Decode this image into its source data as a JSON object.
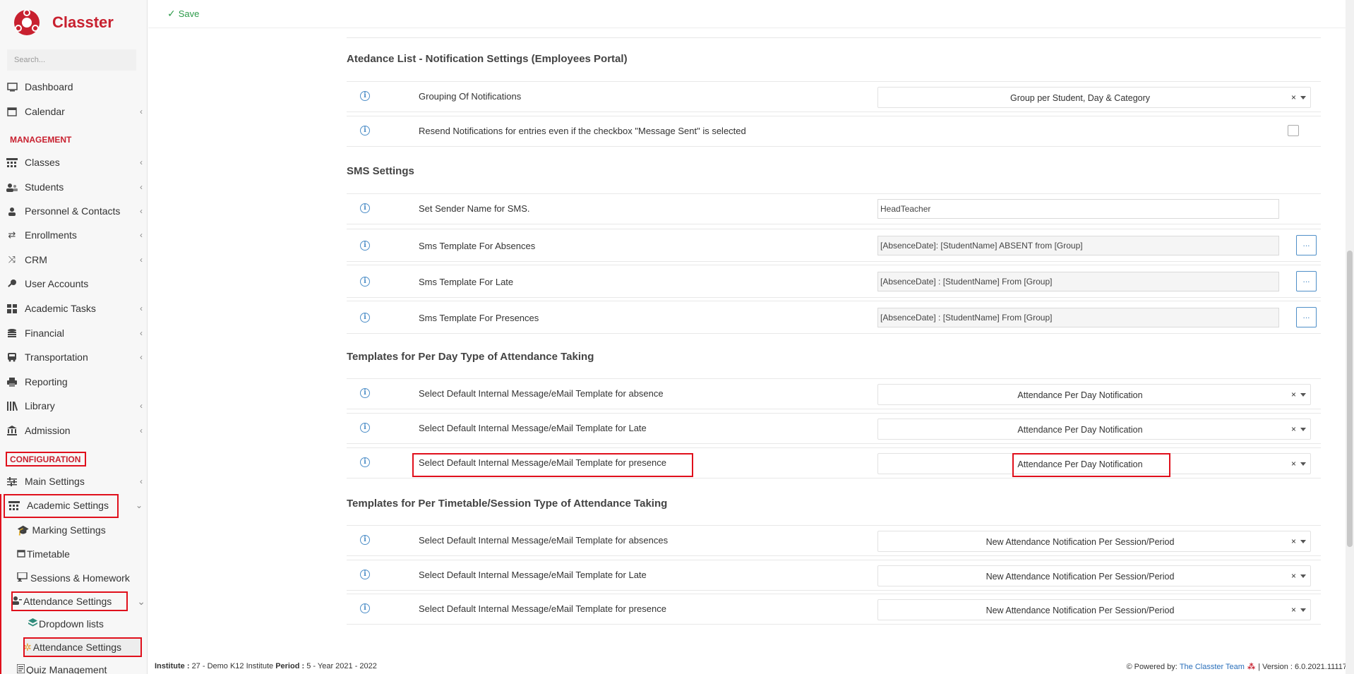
{
  "app": {
    "name": "Classter"
  },
  "toolbar": {
    "save_label": "Save"
  },
  "sidebar": {
    "search_placeholder": "Search...",
    "top_items": [
      {
        "label": "Dashboard",
        "icon": "monitor-icon"
      },
      {
        "label": "Calendar",
        "icon": "calendar-icon"
      }
    ],
    "management_head": "MANAGEMENT",
    "management_items": [
      {
        "label": "Classes",
        "icon": "classes-icon"
      },
      {
        "label": "Students",
        "icon": "students-icon"
      },
      {
        "label": "Personnel & Contacts",
        "icon": "personnel-icon"
      },
      {
        "label": "Enrollments",
        "icon": "enrollments-icon"
      },
      {
        "label": "CRM",
        "icon": "crm-icon"
      },
      {
        "label": "User Accounts",
        "icon": "key-icon"
      },
      {
        "label": "Academic Tasks",
        "icon": "tasks-icon"
      },
      {
        "label": "Financial",
        "icon": "coins-icon"
      },
      {
        "label": "Transportation",
        "icon": "bus-icon"
      },
      {
        "label": "Reporting",
        "icon": "printer-icon"
      },
      {
        "label": "Library",
        "icon": "library-icon"
      },
      {
        "label": "Admission",
        "icon": "bank-icon"
      }
    ],
    "configuration_head": "CONFIGURATION",
    "config_items": [
      {
        "label": "Main Settings",
        "icon": "sliders-icon"
      },
      {
        "label": "Academic Settings",
        "icon": "academic-icon"
      }
    ],
    "academic_sub": [
      {
        "label": "Marking Settings",
        "icon": "graduation-cap-icon"
      },
      {
        "label": "Timetable",
        "icon": "calendar-small-icon"
      },
      {
        "label": "Sessions & Homework",
        "icon": "sessions-icon"
      },
      {
        "label": "Attendance Settings",
        "icon": "attendance-icon"
      }
    ],
    "attendance_sub": [
      {
        "label": "Dropdown lists",
        "icon": "layers-icon"
      },
      {
        "label": "Attendance Settings",
        "icon": "gear-icon"
      }
    ],
    "quiz": {
      "label": "Quiz Management",
      "icon": "quiz-icon"
    }
  },
  "sections": {
    "notif_title": "Atedance List - Notification Settings (Employees Portal)",
    "sms_title": "SMS Settings",
    "perday_title": "Templates for Per Day Type of Attendance Taking",
    "persession_title": "Templates for Per Timetable/Session Type of Attendance Taking"
  },
  "notif_rows": [
    {
      "label": "Grouping Of Notifications",
      "value": "Group per Student, Day & Category"
    },
    {
      "label": "Resend Notifications for entries even if the checkbox \"Message Sent\" is selected",
      "checked": false
    }
  ],
  "sms_rows": [
    {
      "label": "Set Sender Name for SMS.",
      "value": "HeadTeacher"
    },
    {
      "label": "Sms Template For Absences",
      "value": "[AbsenceDate]: [StudentName] ABSENT from [Group]",
      "button": "..."
    },
    {
      "label": "Sms Template For Late",
      "value": "[AbsenceDate] : [StudentName] From [Group]",
      "button": "..."
    },
    {
      "label": "Sms Template For Presences",
      "value": "[AbsenceDate] : [StudentName] From [Group]",
      "button": "..."
    }
  ],
  "perday_rows": [
    {
      "label": "Select Default Internal Message/eMail Template for absence",
      "value": "Attendance Per Day Notification"
    },
    {
      "label": "Select Default Internal Message/eMail Template for Late",
      "value": "Attendance Per Day Notification"
    },
    {
      "label": "Select Default Internal Message/eMail Template for presence",
      "value": "Attendance Per Day Notification"
    }
  ],
  "persession_rows": [
    {
      "label": "Select Default Internal Message/eMail Template for absences",
      "value": "New Attendance Notification Per Session/Period"
    },
    {
      "label": "Select Default Internal Message/eMail Template for Late",
      "value": "New Attendance Notification Per Session/Period"
    },
    {
      "label": "Select Default Internal Message/eMail Template for presence",
      "value": "New Attendance Notification Per Session/Period"
    }
  ],
  "select_clear": "×",
  "footer": {
    "institute_label": "Institute :",
    "institute_value": "27 - Demo K12 Institute",
    "period_label": "Period :",
    "period_value": "5 - Year 2021 - 2022",
    "powered_by": "Powered by:",
    "team_link": "The Classter Team",
    "version": "| Version : 6.0.2021.11117"
  },
  "colors": {
    "brand_red": "#c8202f",
    "highlight_red": "#e0101c",
    "info_blue": "#4f8fc8",
    "save_green": "#2e9b4b"
  }
}
